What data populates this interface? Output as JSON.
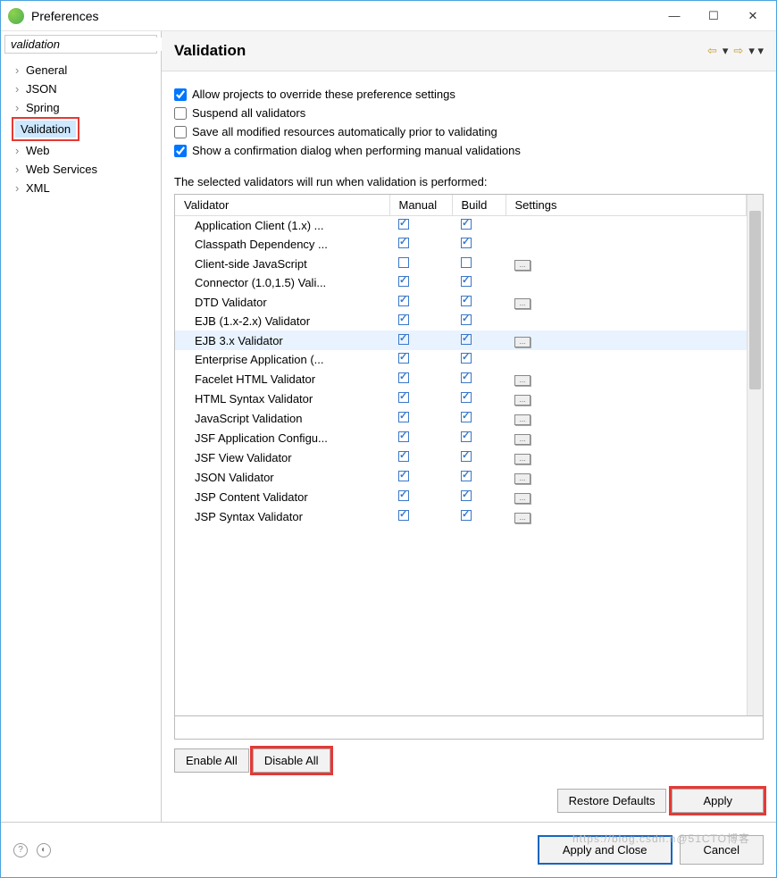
{
  "titlebar": {
    "title": "Preferences"
  },
  "sidebar": {
    "filter": "validation",
    "items": [
      "General",
      "JSON",
      "Spring",
      "Validation",
      "Web",
      "Web Services",
      "XML"
    ],
    "selected": "Validation"
  },
  "header": {
    "title": "Validation"
  },
  "checkboxes": [
    {
      "label": "Allow projects to override these preference settings",
      "checked": true
    },
    {
      "label": "Suspend all validators",
      "checked": false
    },
    {
      "label": "Save all modified resources automatically prior to validating",
      "checked": false
    },
    {
      "label": "Show a confirmation dialog when performing manual validations",
      "checked": true
    }
  ],
  "table": {
    "caption": "The selected validators will run when validation is performed:",
    "cols": [
      "Validator",
      "Manual",
      "Build",
      "Settings"
    ],
    "rows": [
      {
        "name": "Application Client (1.x) ...",
        "manual": true,
        "build": true,
        "settings": false,
        "sel": false
      },
      {
        "name": "Classpath Dependency ...",
        "manual": true,
        "build": true,
        "settings": false,
        "sel": false
      },
      {
        "name": "Client-side JavaScript",
        "manual": false,
        "build": false,
        "settings": true,
        "sel": false
      },
      {
        "name": "Connector (1.0,1.5) Vali...",
        "manual": true,
        "build": true,
        "settings": false,
        "sel": false
      },
      {
        "name": "DTD Validator",
        "manual": true,
        "build": true,
        "settings": true,
        "sel": false
      },
      {
        "name": "EJB (1.x-2.x) Validator",
        "manual": true,
        "build": true,
        "settings": false,
        "sel": false
      },
      {
        "name": "EJB 3.x Validator",
        "manual": true,
        "build": true,
        "settings": true,
        "sel": true
      },
      {
        "name": "Enterprise Application (...",
        "manual": true,
        "build": true,
        "settings": false,
        "sel": false
      },
      {
        "name": "Facelet HTML Validator",
        "manual": true,
        "build": true,
        "settings": true,
        "sel": false
      },
      {
        "name": "HTML Syntax Validator",
        "manual": true,
        "build": true,
        "settings": true,
        "sel": false
      },
      {
        "name": "JavaScript Validation",
        "manual": true,
        "build": true,
        "settings": true,
        "sel": false
      },
      {
        "name": "JSF Application Configu...",
        "manual": true,
        "build": true,
        "settings": true,
        "sel": false
      },
      {
        "name": "JSF View Validator",
        "manual": true,
        "build": true,
        "settings": true,
        "sel": false
      },
      {
        "name": "JSON Validator",
        "manual": true,
        "build": true,
        "settings": true,
        "sel": false
      },
      {
        "name": "JSP Content Validator",
        "manual": true,
        "build": true,
        "settings": true,
        "sel": false
      },
      {
        "name": "JSP Syntax Validator",
        "manual": true,
        "build": true,
        "settings": true,
        "sel": false
      }
    ]
  },
  "buttons": {
    "enableAll": "Enable All",
    "disableAll": "Disable All",
    "restoreDefaults": "Restore Defaults",
    "apply": "Apply",
    "applyClose": "Apply and Close",
    "cancel": "Cancel"
  },
  "watermark": "https://blog.csdn.n@51CTO博客"
}
